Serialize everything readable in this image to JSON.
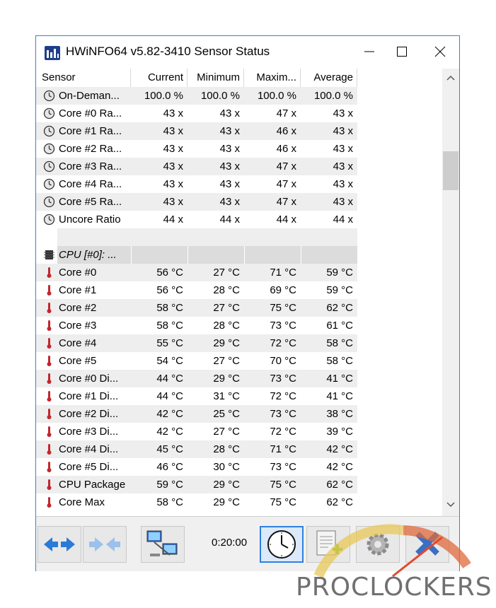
{
  "window": {
    "title": "HWiNFO64 v5.82-3410 Sensor Status",
    "minimize_label": "minimize",
    "maximize_label": "maximize",
    "close_label": "close"
  },
  "columns": [
    "Sensor",
    "Current",
    "Minimum",
    "Maxim...",
    "Average"
  ],
  "rows": [
    {
      "icon": "clock-icon",
      "name": "On-Deman...",
      "current": "100.0 %",
      "min": "100.0 %",
      "max": "100.0 %",
      "avg": "100.0 %"
    },
    {
      "icon": "clock-icon",
      "name": "Core #0 Ra...",
      "current": "43 x",
      "min": "43 x",
      "max": "47 x",
      "avg": "43 x"
    },
    {
      "icon": "clock-icon",
      "name": "Core #1 Ra...",
      "current": "43 x",
      "min": "43 x",
      "max": "46 x",
      "avg": "43 x"
    },
    {
      "icon": "clock-icon",
      "name": "Core #2 Ra...",
      "current": "43 x",
      "min": "43 x",
      "max": "46 x",
      "avg": "43 x"
    },
    {
      "icon": "clock-icon",
      "name": "Core #3 Ra...",
      "current": "43 x",
      "min": "43 x",
      "max": "47 x",
      "avg": "43 x"
    },
    {
      "icon": "clock-icon",
      "name": "Core #4 Ra...",
      "current": "43 x",
      "min": "43 x",
      "max": "47 x",
      "avg": "43 x"
    },
    {
      "icon": "clock-icon",
      "name": "Core #5 Ra...",
      "current": "43 x",
      "min": "43 x",
      "max": "47 x",
      "avg": "43 x"
    },
    {
      "icon": "clock-icon",
      "name": "Uncore Ratio",
      "current": "44 x",
      "min": "44 x",
      "max": "44 x",
      "avg": "44 x"
    },
    {
      "icon": "",
      "name": "",
      "current": "",
      "min": "",
      "max": "",
      "avg": "",
      "blank": true
    },
    {
      "icon": "chip-icon",
      "name": "CPU [#0]: ...",
      "current": "",
      "min": "",
      "max": "",
      "avg": "",
      "group": true
    },
    {
      "icon": "thermometer-icon",
      "name": "Core #0",
      "current": "56 °C",
      "min": "27 °C",
      "max": "71 °C",
      "avg": "59 °C"
    },
    {
      "icon": "thermometer-icon",
      "name": "Core #1",
      "current": "56 °C",
      "min": "28 °C",
      "max": "69 °C",
      "avg": "59 °C"
    },
    {
      "icon": "thermometer-icon",
      "name": "Core #2",
      "current": "58 °C",
      "min": "27 °C",
      "max": "75 °C",
      "avg": "62 °C"
    },
    {
      "icon": "thermometer-icon",
      "name": "Core #3",
      "current": "58 °C",
      "min": "28 °C",
      "max": "73 °C",
      "avg": "61 °C"
    },
    {
      "icon": "thermometer-icon",
      "name": "Core #4",
      "current": "55 °C",
      "min": "29 °C",
      "max": "72 °C",
      "avg": "58 °C"
    },
    {
      "icon": "thermometer-icon",
      "name": "Core #5",
      "current": "54 °C",
      "min": "27 °C",
      "max": "70 °C",
      "avg": "58 °C"
    },
    {
      "icon": "thermometer-icon",
      "name": "Core #0 Di...",
      "current": "44 °C",
      "min": "29 °C",
      "max": "73 °C",
      "avg": "41 °C"
    },
    {
      "icon": "thermometer-icon",
      "name": "Core #1 Di...",
      "current": "44 °C",
      "min": "31 °C",
      "max": "72 °C",
      "avg": "41 °C"
    },
    {
      "icon": "thermometer-icon",
      "name": "Core #2 Di...",
      "current": "42 °C",
      "min": "25 °C",
      "max": "73 °C",
      "avg": "38 °C"
    },
    {
      "icon": "thermometer-icon",
      "name": "Core #3 Di...",
      "current": "42 °C",
      "min": "27 °C",
      "max": "72 °C",
      "avg": "39 °C"
    },
    {
      "icon": "thermometer-icon",
      "name": "Core #4 Di...",
      "current": "45 °C",
      "min": "28 °C",
      "max": "71 °C",
      "avg": "42 °C"
    },
    {
      "icon": "thermometer-icon",
      "name": "Core #5 Di...",
      "current": "46 °C",
      "min": "30 °C",
      "max": "73 °C",
      "avg": "42 °C"
    },
    {
      "icon": "thermometer-icon",
      "name": "CPU Package",
      "current": "59 °C",
      "min": "29 °C",
      "max": "75 °C",
      "avg": "62 °C"
    },
    {
      "icon": "thermometer-icon",
      "name": "Core Max",
      "current": "58 °C",
      "min": "29 °C",
      "max": "75 °C",
      "avg": "62 °C"
    }
  ],
  "toolbar": {
    "timer": "0:20:00",
    "buttons": [
      "expand-arrows-icon",
      "collapse-arrows-icon",
      "network-computers-icon",
      "clock-icon",
      "report-add-icon",
      "settings-gear-icon",
      "close-sensor-icon"
    ]
  },
  "watermark": {
    "text": "PROCLOCKERS"
  },
  "colors": {
    "accent": "#2f7fe0",
    "row_alt": "#eeeeee",
    "group_bg": "#dcdcdc",
    "thermo": "#c0282d",
    "watermark": "#707070"
  }
}
